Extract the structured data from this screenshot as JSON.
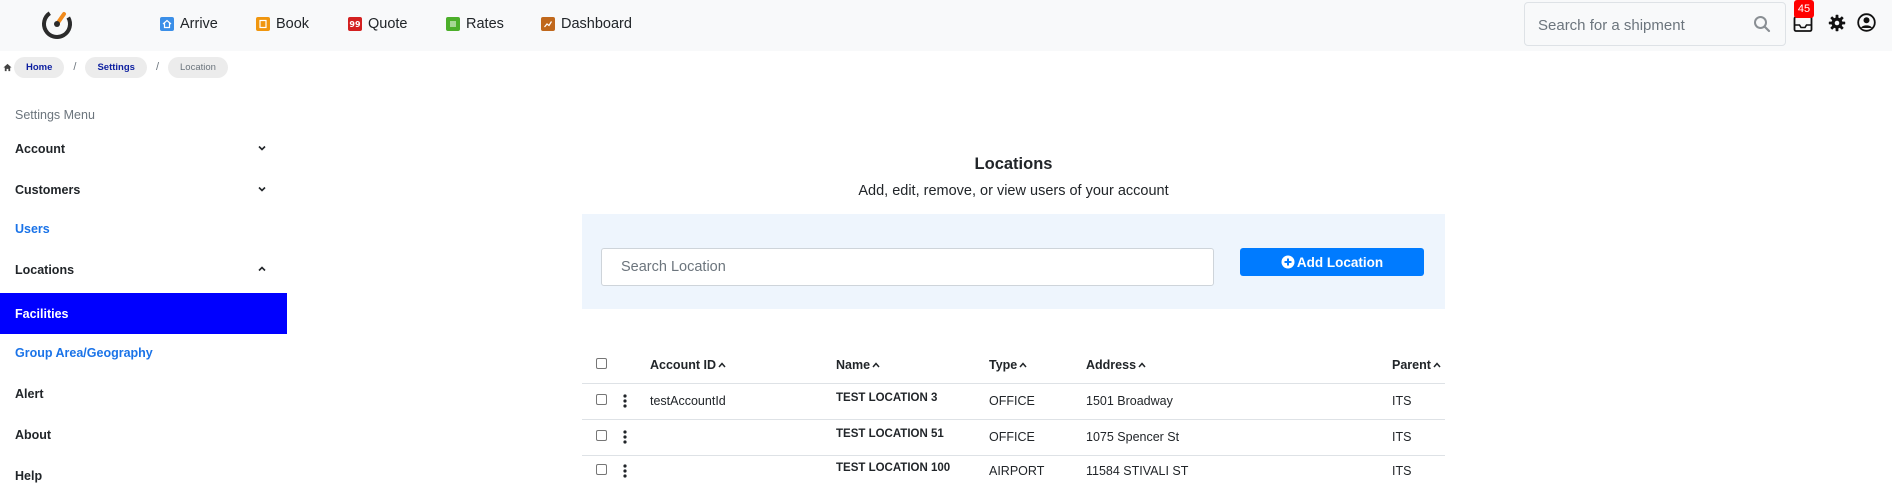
{
  "nav": {
    "items": [
      {
        "label": "Arrive",
        "icon": "home-icon",
        "color": "#3b8fe8"
      },
      {
        "label": "Book",
        "icon": "book-icon",
        "color": "#f0960e"
      },
      {
        "label": "Quote",
        "icon": "quote-icon",
        "color": "#d32020"
      },
      {
        "label": "Rates",
        "icon": "rates-icon",
        "color": "#4caf2a"
      },
      {
        "label": "Dashboard",
        "icon": "dashboard-icon",
        "color": "#c0681c"
      }
    ],
    "search_placeholder": "Search for a shipment",
    "notification_count": "45"
  },
  "breadcrumb": [
    "Home",
    "Settings",
    "Location"
  ],
  "sidebar": {
    "title": "Settings Menu",
    "items": [
      {
        "label": "Account"
      },
      {
        "label": "Customers"
      },
      {
        "label": "Users"
      },
      {
        "label": "Locations"
      },
      {
        "label": "Facilities"
      },
      {
        "label": "Group Area/Geography"
      },
      {
        "label": "Alert"
      },
      {
        "label": "About"
      },
      {
        "label": "Help"
      }
    ]
  },
  "main": {
    "title": "Locations",
    "subtitle": "Add, edit, remove, or view users of your account",
    "search_placeholder": "Search Location",
    "add_button": "Add Location"
  },
  "table": {
    "columns": [
      "Account ID",
      "Name",
      "Type",
      "Address",
      "Parent"
    ],
    "rows": [
      {
        "account_id": "testAccountId",
        "name": "TEST LOCATION 3",
        "type": "OFFICE",
        "address": "1501 Broadway",
        "parent": "ITS"
      },
      {
        "account_id": "",
        "name": "TEST LOCATION 51",
        "type": "OFFICE",
        "address": "1075 Spencer St",
        "parent": "ITS"
      },
      {
        "account_id": "",
        "name": "TEST LOCATION 100",
        "type": "AIRPORT",
        "address": "11584 STIVALI ST",
        "parent": "ITS"
      }
    ]
  }
}
